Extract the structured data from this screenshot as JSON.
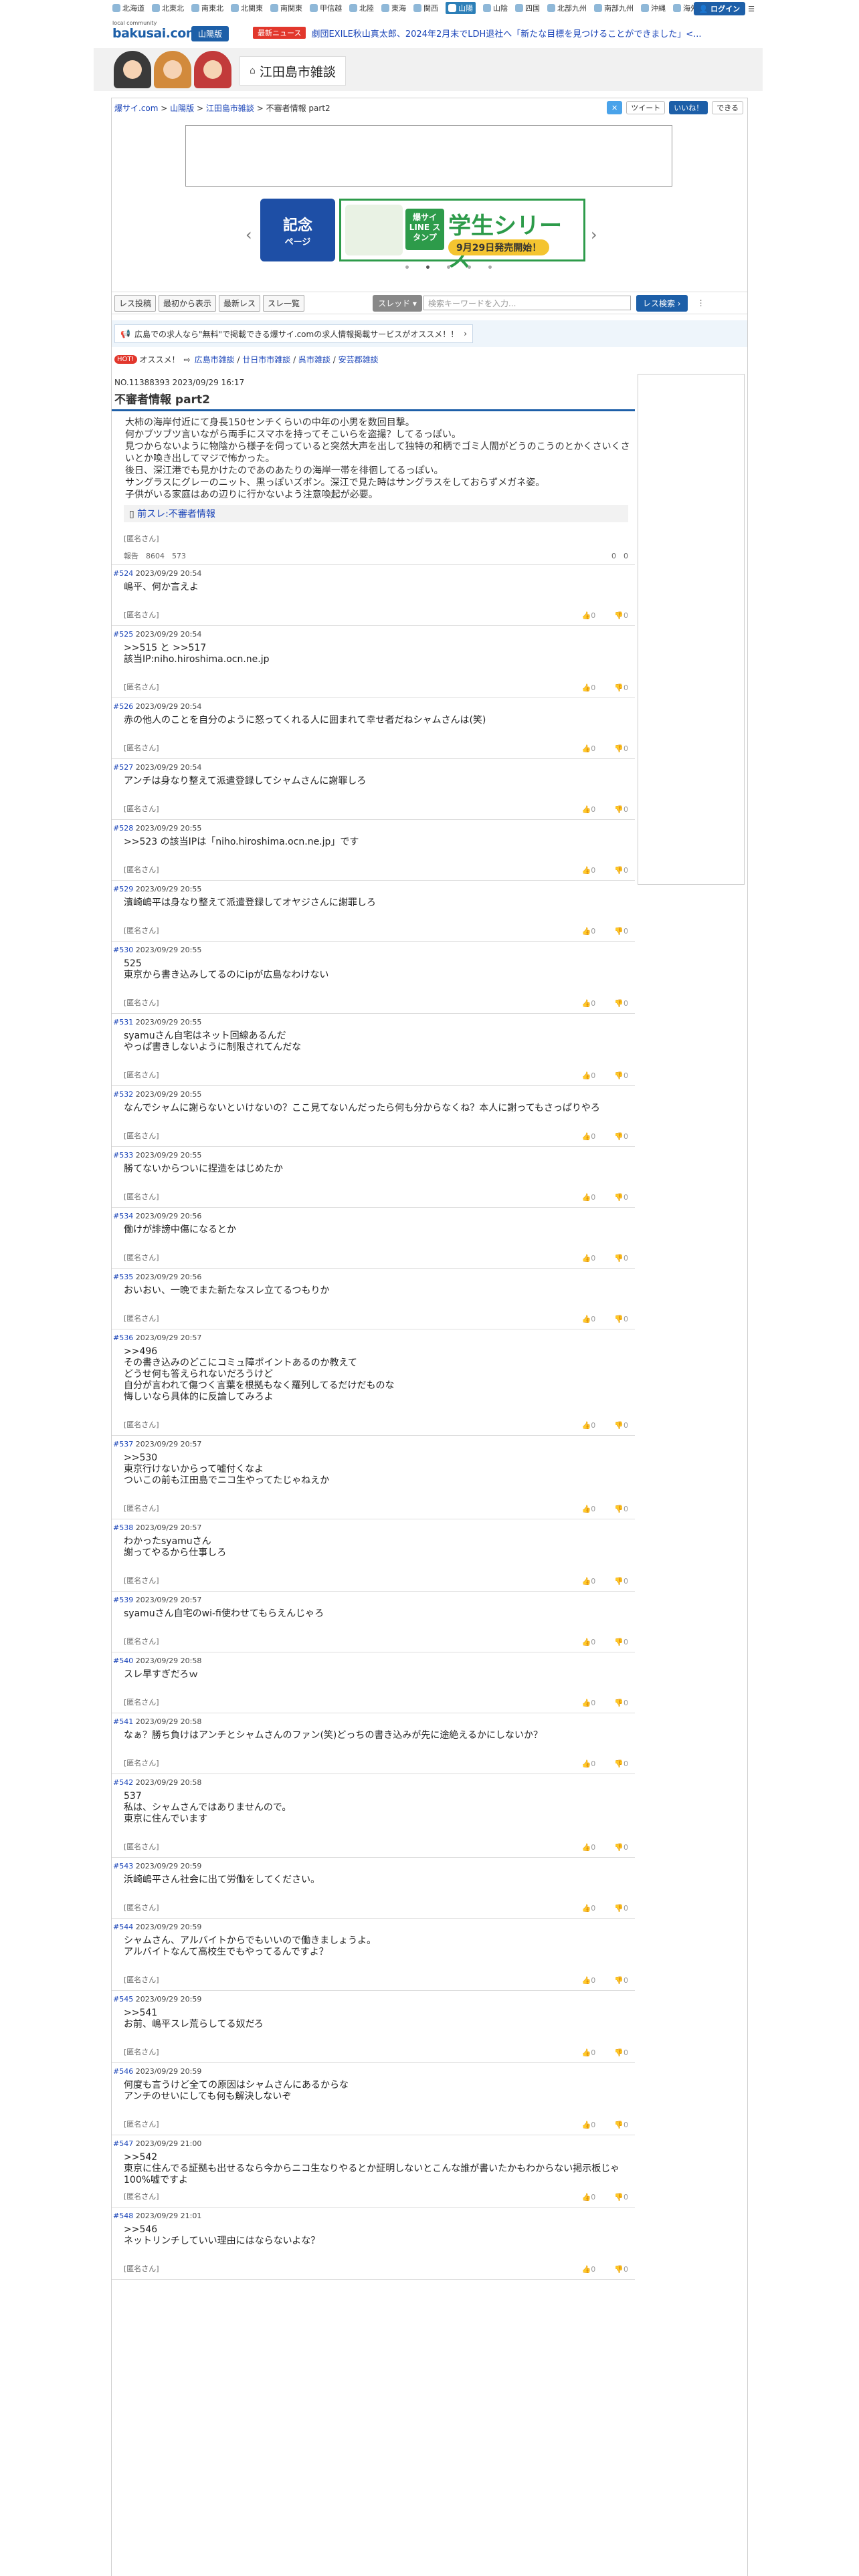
{
  "regions": [
    "北海道",
    "北東北",
    "南東北",
    "北関東",
    "南関東",
    "甲信越",
    "北陸",
    "東海",
    "関西",
    "山陽",
    "山陰",
    "四国",
    "北部九州",
    "南部九州",
    "沖縄",
    "海外"
  ],
  "active_region": "山陽",
  "login_label": "ログイン",
  "logo": {
    "small": "local community",
    "main": "bakusai.com"
  },
  "area_tab": "山陽版",
  "news": {
    "badge": "最新ニュース",
    "text": "劇団EXILE秋山真太郎、2024年2月末でLDH退社へ「新たな目標を見つけることができました」<..."
  },
  "board_name": "江田島市雑談",
  "breadcrumb": {
    "site": "爆サイ.com",
    "area": "山陽版",
    "board": "江田島市雑談",
    "thread": "不審者情報 part2"
  },
  "share": {
    "tweet": "ツイート",
    "good": "いいね！",
    "dekiru": "できる"
  },
  "carousel": {
    "kinen": "記念",
    "kinen_sub": "ページ",
    "line_text": "爆サイ LINE スタンプ",
    "title": "学生シリーズ",
    "date": "9月29日発売開始！"
  },
  "toolbar": {
    "post": "レス投稿",
    "from_first": "最初から表示",
    "latest": "最新レス",
    "thread_list": "スレ一覧",
    "select": "スレッド",
    "search_placeholder": "検索キーワードを入力...",
    "search_btn": "レス検索"
  },
  "recruit_text": "広島での求人なら\"無料\"で掲載できる爆サイ.comの求人情報掲載サービスがオススメ！！",
  "hot": {
    "badge": "HOT!",
    "label": "オススメ！",
    "links": [
      "広島市雑談",
      "廿日市市雑談",
      "呉市雑談",
      "安芸郡雑談"
    ]
  },
  "op": {
    "meta": "NO.11388393 2023/09/29 16:17",
    "title": "不審者情報 part2",
    "body": "大柿の海岸付近にて身長150センチくらいの中年の小男を数回目撃。\n何かブツブツ言いながら両手にスマホを持ってそこいらを盗撮？してるっぽい。\n見つからないように物陰から様子を伺っていると突然大声を出して独特の和柄でゴミ人間がどうのこうのとかくさいくさいとか喚き出してマジで怖かった。\n後日、深江港でも見かけたのであのあたりの海岸一帯を徘徊してるっぽい。\nサングラスにグレーのニット、黒っぽいズボン。深江で見た時はサングラスをしておらずメガネ姿。\n子供がいる家庭はあの辺りに行かないよう注意喚起が必要。",
    "prev_link": "前スレ:不審者情報",
    "author": "[匿名さん]",
    "stats": "報告　8604　573",
    "votes": "0　0"
  },
  "posts": [
    {
      "num": "#524",
      "date": "2023/09/29 20:54",
      "body": "嶋平、何か言えよ",
      "author": "[匿名さん]"
    },
    {
      "num": "#525",
      "date": "2023/09/29 20:54",
      "body": ">>515 と >>517\n該当IP:niho.hiroshima.ocn.ne.jp",
      "author": "[匿名さん]"
    },
    {
      "num": "#526",
      "date": "2023/09/29 20:54",
      "body": "赤の他人のことを自分のように怒ってくれる人に囲まれて幸せ者だねシャムさんは(笑)",
      "author": "[匿名さん]"
    },
    {
      "num": "#527",
      "date": "2023/09/29 20:54",
      "body": "アンチは身なり整えて派遣登録してシャムさんに謝罪しろ",
      "author": "[匿名さん]"
    },
    {
      "num": "#528",
      "date": "2023/09/29 20:55",
      "body": ">>523 の該当IPは「niho.hiroshima.ocn.ne.jp」です",
      "author": "[匿名さん]"
    },
    {
      "num": "#529",
      "date": "2023/09/29 20:55",
      "body": "濱崎嶋平は身なり整えて派遣登録してオヤジさんに謝罪しろ",
      "author": "[匿名さん]"
    },
    {
      "num": "#530",
      "date": "2023/09/29 20:55",
      "body": "525\n東京から書き込みしてるのにipが広島なわけない",
      "author": "[匿名さん]"
    },
    {
      "num": "#531",
      "date": "2023/09/29 20:55",
      "body": "syamuさん自宅はネット回線あるんだ\nやっぱ書きしないように制限されてんだな",
      "author": "[匿名さん]"
    },
    {
      "num": "#532",
      "date": "2023/09/29 20:55",
      "body": "なんでシャムに謝らないといけないの？ここ見てないんだったら何も分からなくね？本人に謝ってもさっぱりやろ",
      "author": "[匿名さん]"
    },
    {
      "num": "#533",
      "date": "2023/09/29 20:55",
      "body": "勝てないからついに捏造をはじめたか",
      "author": "[匿名さん]"
    },
    {
      "num": "#534",
      "date": "2023/09/29 20:56",
      "body": "働けが誹謗中傷になるとか",
      "author": "[匿名さん]"
    },
    {
      "num": "#535",
      "date": "2023/09/29 20:56",
      "body": "おいおい、一晩でまた新たなスレ立てるつもりか",
      "author": "[匿名さん]"
    },
    {
      "num": "#536",
      "date": "2023/09/29 20:57",
      "body": ">>496\nその書き込みのどこにコミュ障ポイントあるのか教えて\nどうせ何も答えられないだろうけど\n自分が言われて傷つく言葉を根拠もなく羅列してるだけだものな\n悔しいなら具体的に反論してみろよ",
      "author": "[匿名さん]"
    },
    {
      "num": "#537",
      "date": "2023/09/29 20:57",
      "body": ">>530\n東京行けないからって嘘付くなよ\nついこの前も江田島でニコ生やってたじゃねえか",
      "author": "[匿名さん]"
    },
    {
      "num": "#538",
      "date": "2023/09/29 20:57",
      "body": "わかったsyamuさん\n謝ってやるから仕事しろ",
      "author": "[匿名さん]"
    },
    {
      "num": "#539",
      "date": "2023/09/29 20:57",
      "body": "syamuさん自宅のwi-fi使わせてもらえんじゃろ",
      "author": "[匿名さん]"
    },
    {
      "num": "#540",
      "date": "2023/09/29 20:58",
      "body": "スレ早すぎだろｗ",
      "author": "[匿名さん]"
    },
    {
      "num": "#541",
      "date": "2023/09/29 20:58",
      "body": "なぁ？勝ち負けはアンチとシャムさんのファン(笑)どっちの書き込みが先に途絶えるかにしないか？",
      "author": "[匿名さん]"
    },
    {
      "num": "#542",
      "date": "2023/09/29 20:58",
      "body": "537\n私は、シャムさんではありませんので。\n東京に住んでいます",
      "author": "[匿名さん]"
    },
    {
      "num": "#543",
      "date": "2023/09/29 20:59",
      "body": "浜崎嶋平さん社会に出て労働をしてください。",
      "author": "[匿名さん]"
    },
    {
      "num": "#544",
      "date": "2023/09/29 20:59",
      "body": "シャムさん、アルバイトからでもいいので働きましょうよ。\nアルバイトなんて高校生でもやってるんですよ？",
      "author": "[匿名さん]"
    },
    {
      "num": "#545",
      "date": "2023/09/29 20:59",
      "body": ">>541\nお前、嶋平スレ荒らしてる奴だろ",
      "author": "[匿名さん]"
    },
    {
      "num": "#546",
      "date": "2023/09/29 20:59",
      "body": "何度も言うけど全ての原因はシャムさんにあるからな\nアンチのせいにしても何も解決しないぞ",
      "author": "[匿名さん]"
    },
    {
      "num": "#547",
      "date": "2023/09/29 21:00",
      "body": ">>542\n東京に住んでる証拠も出せるなら今からニコ生なりやるとか証明しないとこんな誰が書いたかもわからない掲示板じゃ100%嘘ですよ",
      "author": "[匿名さん]"
    },
    {
      "num": "#548",
      "date": "2023/09/29 21:01",
      "body": ">>546\nネットリンチしていい理由にはならないよな？",
      "author": "[匿名さん]"
    }
  ],
  "colors": {
    "accent": "#1d5fa8",
    "link": "#1a44b8",
    "hot": "#e2372c",
    "line_green": "#2d9b4a"
  }
}
